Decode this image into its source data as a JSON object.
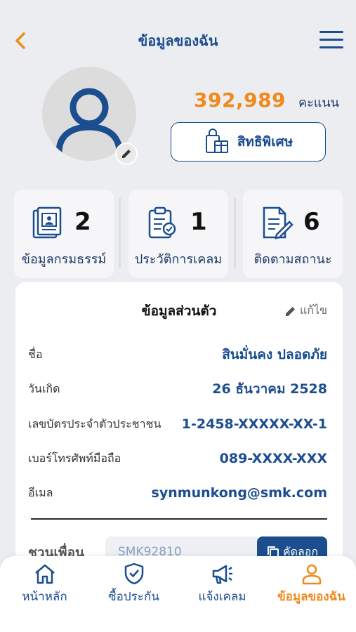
{
  "header": {
    "title": "ข้อมูลของฉัน"
  },
  "profile": {
    "points_value": "392,989",
    "points_unit": "คะแนน",
    "privilege_label": "สิทธิพิเศษ"
  },
  "stats": [
    {
      "value": "2",
      "label": "ข้อมูลกรมธรรม์",
      "icon": "policy-document-icon"
    },
    {
      "value": "1",
      "label": "ประวัติการเคลม",
      "icon": "clipboard-check-icon"
    },
    {
      "value": "6",
      "label": "ติดตามสถานะ",
      "icon": "document-edit-icon"
    }
  ],
  "personal_info": {
    "title": "ข้อมูลส่วนตัว",
    "edit_label": "แก้ไข",
    "rows": [
      {
        "label": "ชื่อ",
        "value": "สินมั่นคง ปลอดภัย"
      },
      {
        "label": "วันเกิด",
        "value": "26 ธันวาคม 2528"
      },
      {
        "label": "เลขบัตรประจำตัวประชาชน",
        "value": "1-2458-XXXXX-XX-1"
      },
      {
        "label": "เบอร์โทรศัพท์มือถือ",
        "value": "089-XXXX-XXX"
      },
      {
        "label": "อีเมล",
        "value": "synmunkong@smk.com"
      }
    ],
    "invite_label": "ชวนเพื่อน",
    "invite_code": "SMK92810",
    "copy_label": "คัดลอก"
  },
  "tabbar": {
    "items": [
      {
        "label": "หน้าหลัก",
        "icon": "home-icon"
      },
      {
        "label": "ซื้อประกัน",
        "icon": "shield-check-icon"
      },
      {
        "label": "แจ้งเคลม",
        "icon": "megaphone-icon"
      },
      {
        "label": "ข้อมูลของฉัน",
        "icon": "user-icon"
      }
    ],
    "active_index": 3
  },
  "colors": {
    "primary": "#1b4d8f",
    "accent": "#f08a1c",
    "background": "#ecedf1"
  }
}
